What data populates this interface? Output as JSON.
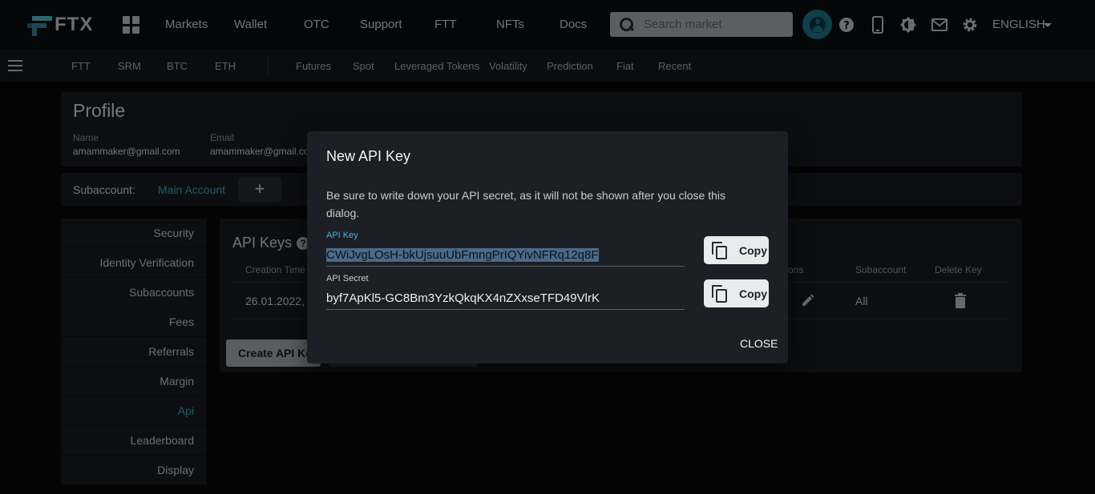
{
  "header": {
    "brand": "FTX",
    "nav": [
      "Markets",
      "Wallet",
      "OTC",
      "Support",
      "FTT",
      "NFTs",
      "Docs"
    ],
    "search_placeholder": "Search market",
    "language": "ENGLISH"
  },
  "subnav": {
    "pinned": [
      "FTT",
      "SRM",
      "BTC",
      "ETH"
    ],
    "categories": [
      "Futures",
      "Spot",
      "Leveraged Tokens",
      "Volatility",
      "Prediction",
      "Fiat",
      "Recent"
    ]
  },
  "profile": {
    "title": "Profile",
    "name_label": "Name",
    "name_value": "amammaker@gmail.com",
    "email_label": "Email",
    "email_value": "amammaker@gmail.co",
    "subaccount_label": "Subaccount:",
    "subaccount_value": "Main Account",
    "add_label": "+"
  },
  "sidebar": {
    "items": [
      "Security",
      "Identity Verification",
      "Subaccounts",
      "Fees",
      "Referrals",
      "Margin",
      "Api",
      "Leaderboard",
      "Display"
    ],
    "active": "Api"
  },
  "api_section": {
    "title": "API Keys",
    "help": "?",
    "columns": {
      "creation_time": "Creation Time",
      "permissions": "ons",
      "subaccount": "Subaccount",
      "delete_key": "Delete Key"
    },
    "row": {
      "creation_time": "26.01.2022,",
      "subaccount": "All"
    },
    "create_button": "Create API Key"
  },
  "dialog": {
    "title": "New API Key",
    "message": "Be sure to write down your API secret, as it will not be shown after you close this dialog.",
    "api_key_label": "API Key",
    "api_key_value": "CWiJvgLOsH-bkUjsuuUbFmngPrIQYivNFRq12q8F",
    "api_secret_label": "API Secret",
    "api_secret_value": "byf7ApKl5-GC8Bm3YzkQkqKX4nZXxseTFD49VlrK",
    "copy_label": "Copy",
    "close_label": "CLOSE"
  },
  "colors": {
    "accent": "#3fb5d1",
    "background": "#08090b",
    "panel": "#1a1d23",
    "dialog": "#1c1f25"
  }
}
